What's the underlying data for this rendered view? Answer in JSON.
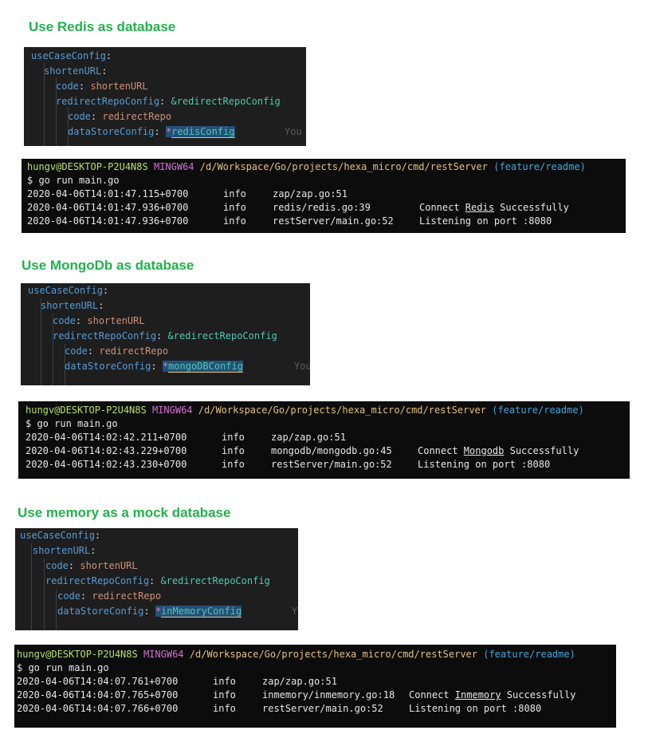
{
  "sections": [
    {
      "heading": "Use Redis as database",
      "config": {
        "root": "useCaseConfig",
        "shorten": "shortenURL",
        "code_key": "code",
        "code_val": "shortenURL",
        "redirect_key": "redirectRepoConfig",
        "redirect_val": "&redirectRepoConfig",
        "inner_code_key": "code",
        "inner_code_val": "redirectRepo",
        "store_key": "dataStoreConfig",
        "store_prefix": "*",
        "store_val": "redisConfig",
        "ghost": "You"
      },
      "terminal": {
        "user": "hungv@DESKTOP-P2U4N8S",
        "env": "MINGW64",
        "path": "/d/Workspace/Go/projects/hexa_micro/cmd/restServer",
        "branch": "(feature/readme)",
        "command": "$ go run main.go",
        "logs": [
          {
            "time": "2020-04-06T14:01:47.115+0700",
            "level": "info",
            "src": "zap/zap.go:51",
            "pre": "",
            "link": "",
            "post": ""
          },
          {
            "time": "2020-04-06T14:01:47.936+0700",
            "level": "info",
            "src": "redis/redis.go:39",
            "pre": "Connect ",
            "link": "Redis",
            "post": " Successfully"
          },
          {
            "time": "2020-04-06T14:01:47.936+0700",
            "level": "info",
            "src": "restServer/main.go:52",
            "pre": "Listening on port :8080",
            "link": "",
            "post": ""
          }
        ]
      }
    },
    {
      "heading": "Use MongoDb as database",
      "config": {
        "root": "useCaseConfig",
        "shorten": "shortenURL",
        "code_key": "code",
        "code_val": "shortenURL",
        "redirect_key": "redirectRepoConfig",
        "redirect_val": "&redirectRepoConfig",
        "inner_code_key": "code",
        "inner_code_val": "redirectRepo",
        "store_key": "dataStoreConfig",
        "store_prefix": "*",
        "store_val": "mongoDBConfig",
        "ghost": "You"
      },
      "terminal": {
        "user": "hungv@DESKTOP-P2U4N8S",
        "env": "MINGW64",
        "path": "/d/Workspace/Go/projects/hexa_micro/cmd/restServer",
        "branch": "(feature/readme)",
        "command": "$ go run main.go",
        "logs": [
          {
            "time": "2020-04-06T14:02:42.211+0700",
            "level": "info",
            "src": "zap/zap.go:51",
            "pre": "",
            "link": "",
            "post": ""
          },
          {
            "time": "2020-04-06T14:02:43.229+0700",
            "level": "info",
            "src": "mongodb/mongodb.go:45",
            "pre": "Connect ",
            "link": "Mongodb",
            "post": " Successfully"
          },
          {
            "time": "2020-04-06T14:02:43.230+0700",
            "level": "info",
            "src": "restServer/main.go:52",
            "pre": "Listening on port :8080",
            "link": "",
            "post": ""
          }
        ]
      }
    },
    {
      "heading": "Use memory as a mock database",
      "config": {
        "root": "useCaseConfig",
        "shorten": "shortenURL",
        "code_key": "code",
        "code_val": "shortenURL",
        "redirect_key": "redirectRepoConfig",
        "redirect_val": "&redirectRepoConfig",
        "inner_code_key": "code",
        "inner_code_val": "redirectRepo",
        "store_key": "dataStoreConfig",
        "store_prefix": "*",
        "store_val": "inMemoryConfig",
        "ghost": "Y"
      },
      "terminal": {
        "user": "hungv@DESKTOP-P2U4N8S",
        "env": "MINGW64",
        "path": "/d/Workspace/Go/projects/hexa_micro/cmd/restServer",
        "branch": "(feature/readme)",
        "command": "$ go run main.go",
        "logs": [
          {
            "time": "2020-04-06T14:04:07.761+0700",
            "level": "info",
            "src": "zap/zap.go:51",
            "pre": "",
            "link": "",
            "post": ""
          },
          {
            "time": "2020-04-06T14:04:07.765+0700",
            "level": "info",
            "src": "inmemory/inmemory.go:18",
            "pre": "Connect ",
            "link": "Inmemory",
            "post": " Successfully"
          },
          {
            "time": "2020-04-06T14:04:07.766+0700",
            "level": "info",
            "src": "restServer/main.go:52",
            "pre": "Listening on port :8080",
            "link": "",
            "post": ""
          }
        ]
      }
    }
  ],
  "colors": {
    "heading": "#21b24b",
    "editor_bg": "#1e1e1e",
    "terminal_bg": "#0c0c0c",
    "yaml_key": "#569cd6",
    "yaml_value": "#ce9178",
    "anchor": "#c586c0",
    "anchor_name": "#4ec9b0",
    "prompt_user": "#b7e06a",
    "prompt_env": "#d670d6",
    "prompt_path": "#e5c07b",
    "prompt_branch": "#3ea7e0"
  }
}
